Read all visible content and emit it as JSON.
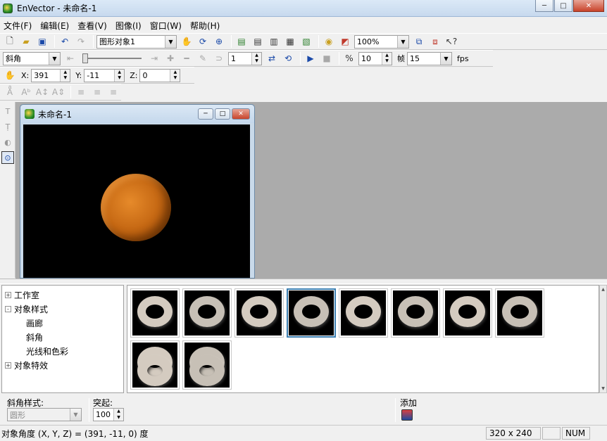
{
  "window": {
    "title": "EnVector - 未命名-1",
    "minimize": "─",
    "maximize": "□",
    "close": "✕"
  },
  "menu": [
    "文件(F)",
    "编辑(E)",
    "查看(V)",
    "图像(I)",
    "窗口(W)",
    "帮助(H)"
  ],
  "toolbar1": {
    "object_select_value": "图形对象1",
    "zoom_value": "100%"
  },
  "toolbar2": {
    "effect_select_value": "斜角",
    "frame_start_value": "1",
    "frame_count_value": "10",
    "frame_label": "帧",
    "fps_value": "15",
    "fps_label": "fps",
    "slider_level": 0.0
  },
  "toolbar3": {
    "x_label": "X:",
    "x_value": "391",
    "y_label": "Y:",
    "y_value": "-11",
    "z_label": "Z:",
    "z_value": "0"
  },
  "document": {
    "title": "未命名-1",
    "canvas_bg": "#000000",
    "disc_color": "#d77a1c"
  },
  "tree": {
    "nodes": [
      {
        "label": "工作室",
        "expander": "+",
        "level": 0
      },
      {
        "label": "对象样式",
        "expander": "-",
        "level": 0
      },
      {
        "label": "画廊",
        "expander": "",
        "level": 1
      },
      {
        "label": "斜角",
        "expander": "",
        "level": 1
      },
      {
        "label": "光线和色彩",
        "expander": "",
        "level": 1
      },
      {
        "label": "对象特效",
        "expander": "+",
        "level": 0
      }
    ]
  },
  "gallery": {
    "count": 10,
    "selected_index": 3
  },
  "bottom_props": {
    "bevel_style_label": "斜角样式:",
    "bevel_style_value": "圆形",
    "bulge_label": "突起:",
    "bulge_value": "100",
    "add_label": "添加"
  },
  "status": {
    "main_text": "对象角度 (X, Y, Z) = (391, -11, 0) 度",
    "size_text": "320 x 240",
    "num_text": "NUM"
  }
}
